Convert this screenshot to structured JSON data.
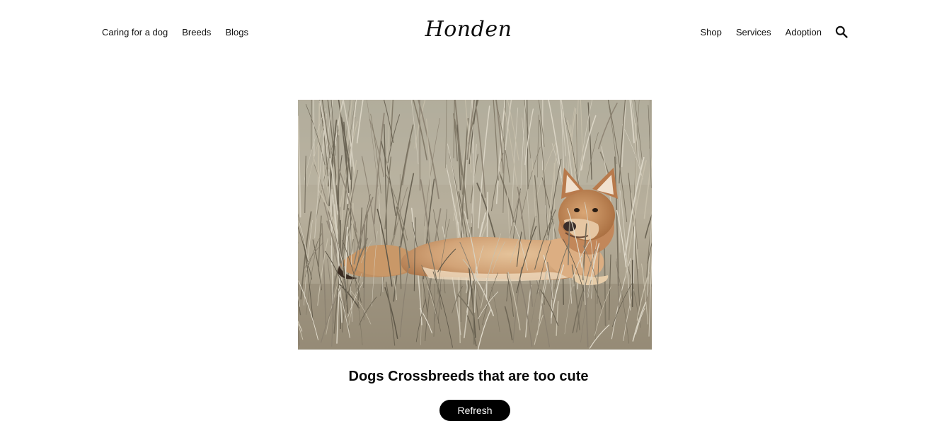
{
  "header": {
    "logo": "Honden",
    "nav_left": [
      {
        "label": "Caring for a dog"
      },
      {
        "label": "Breeds"
      },
      {
        "label": "Blogs"
      }
    ],
    "nav_right": [
      {
        "label": "Shop"
      },
      {
        "label": "Services"
      },
      {
        "label": "Adoption"
      }
    ],
    "search_icon": "search-icon"
  },
  "main": {
    "image_subject": "dhole-lying-in-dry-grass",
    "caption": "Dogs Crossbreeds that are too cute",
    "refresh_label": "Refresh"
  },
  "colors": {
    "background": "#ffffff",
    "text": "#111111",
    "button_bg": "#000000",
    "button_text": "#ffffff"
  }
}
